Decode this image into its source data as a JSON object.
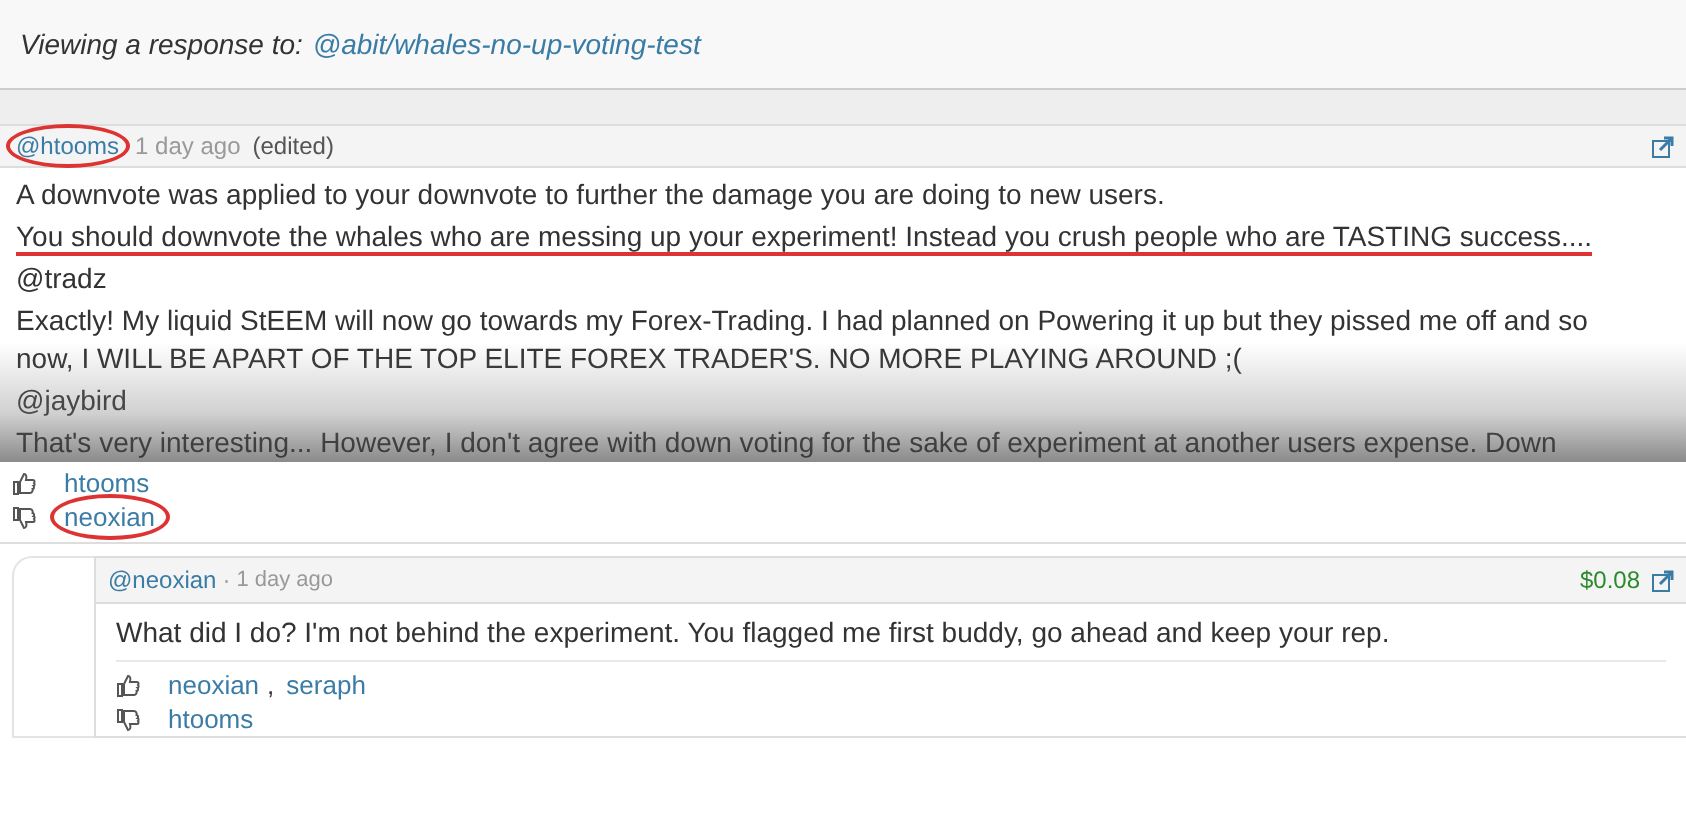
{
  "banner": {
    "label": "Viewing a response to:",
    "link": "@abit/whales-no-up-voting-test"
  },
  "comment": {
    "author": "@htooms",
    "author_circled": true,
    "time": "1 day ago",
    "edited": "(edited)",
    "paragraphs": [
      {
        "text": "A downvote was applied to your downvote to further the damage you are doing to new users.",
        "underlined": false
      },
      {
        "text": "You should downvote the whales who are messing up your experiment! Instead you crush people who are TASTING success....",
        "underlined": true
      },
      {
        "text": "@tradz",
        "underlined": false
      },
      {
        "text": "Exactly! My liquid StEEM will now go towards my Forex-Trading. I had planned on Powering it up but they pissed me off and so now, I WILL BE APART OF THE TOP ELITE FOREX TRADER'S. NO MORE PLAYING AROUND ;(",
        "underlined": false
      },
      {
        "text": "@jaybird",
        "underlined": false
      },
      {
        "text": "That's very interesting... However, I don't agree with down voting for the sake of experiment at another users expense. Down",
        "underlined": false
      }
    ],
    "votes": [
      {
        "kind": "up",
        "voters": [
          "htooms"
        ],
        "circled": false
      },
      {
        "kind": "down",
        "voters": [
          "neoxian"
        ],
        "circled": true
      }
    ]
  },
  "reply": {
    "author": "@neoxian",
    "separator": "·",
    "time": "1 day ago",
    "payout": "$0.08",
    "text": "What did I do? I'm not behind the experiment. You flagged me first buddy, go ahead and keep your rep.",
    "votes": [
      {
        "kind": "up",
        "voters": [
          "neoxian",
          "seraph"
        ],
        "separator": ",",
        "circled": false
      },
      {
        "kind": "down",
        "voters": [
          "htooms"
        ],
        "circled": false
      }
    ]
  }
}
